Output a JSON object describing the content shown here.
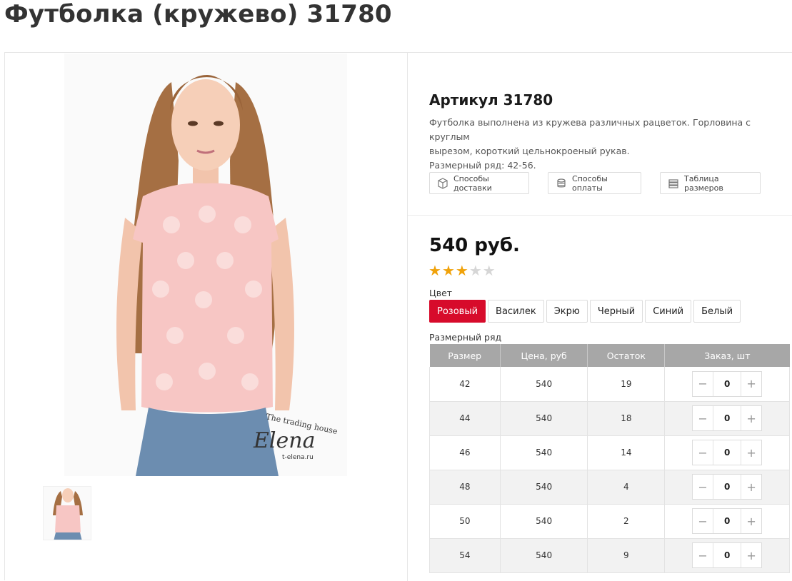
{
  "product": {
    "title": "Футболка (кружево) 31780",
    "article": "Артикул 31780",
    "description_line1": "Футболка выполнена из кружева различных рацветок. Горловина с круглым",
    "description_line2": "вырезом, короткий цельнокроеный рукав.",
    "description_line3": "Размерный ряд: 42-56.",
    "price": "540 руб.",
    "rating": 3,
    "rating_max": 5,
    "watermark_line1": "The trading house",
    "watermark_line2": "Elena",
    "watermark_line3": "t-elena.ru"
  },
  "info_buttons": {
    "delivery": "Способы доставки",
    "payment": "Способы оплаты",
    "sizes": "Таблица размеров"
  },
  "colors": {
    "label": "Цвет",
    "options": [
      "Розовый",
      "Василек",
      "Экрю",
      "Черный",
      "Синий",
      "Белый"
    ],
    "selected": "Розовый",
    "accent": "#d70b2b"
  },
  "size_table": {
    "label": "Размерный ряд",
    "headers": [
      "Размер",
      "Цена, руб",
      "Остаток",
      "Заказ, шт"
    ],
    "rows": [
      {
        "size": "42",
        "price": "540",
        "stock": "19",
        "qty": "0"
      },
      {
        "size": "44",
        "price": "540",
        "stock": "18",
        "qty": "0"
      },
      {
        "size": "46",
        "price": "540",
        "stock": "14",
        "qty": "0"
      },
      {
        "size": "48",
        "price": "540",
        "stock": "4",
        "qty": "0"
      },
      {
        "size": "50",
        "price": "540",
        "stock": "2",
        "qty": "0"
      },
      {
        "size": "54",
        "price": "540",
        "stock": "9",
        "qty": "0"
      }
    ],
    "minus": "−",
    "plus": "+"
  },
  "icons": {
    "delivery": "box-icon",
    "payment": "coins-icon",
    "sizes": "stack-icon"
  }
}
